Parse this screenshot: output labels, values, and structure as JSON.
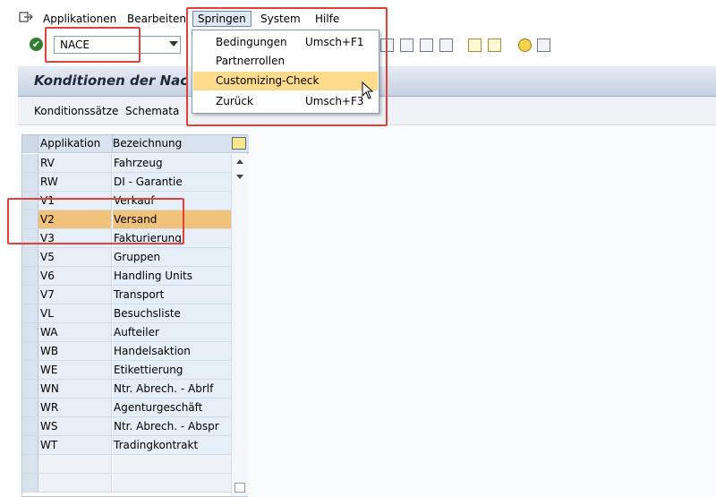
{
  "menubar": {
    "items": [
      "Applikationen",
      "Bearbeiten",
      "Springen",
      "System",
      "Hilfe"
    ]
  },
  "toolbar": {
    "command_value": "NACE"
  },
  "title": "Konditionen der Nac",
  "app_toolbar": {
    "buttons": [
      "Konditionssätze",
      "Schemata"
    ]
  },
  "table": {
    "headers": [
      "Applikation",
      "Bezeichnung"
    ],
    "rows": [
      {
        "app": "RV",
        "desc": "Fahrzeug"
      },
      {
        "app": "RW",
        "desc": "DI - Garantie"
      },
      {
        "app": "V1",
        "desc": "Verkauf"
      },
      {
        "app": "V2",
        "desc": "Versand"
      },
      {
        "app": "V3",
        "desc": "Fakturierung"
      },
      {
        "app": "V5",
        "desc": "Gruppen"
      },
      {
        "app": "V6",
        "desc": "Handling Units"
      },
      {
        "app": "V7",
        "desc": "Transport"
      },
      {
        "app": "VL",
        "desc": "Besuchsliste"
      },
      {
        "app": "WA",
        "desc": "Aufteiler"
      },
      {
        "app": "WB",
        "desc": "Handelsaktion"
      },
      {
        "app": "WE",
        "desc": "Etikettierung"
      },
      {
        "app": "WN",
        "desc": "Ntr. Abrech. - Abrlf"
      },
      {
        "app": "WR",
        "desc": "Agenturgeschäft"
      },
      {
        "app": "WS",
        "desc": "Ntr. Abrech. - Abspr"
      },
      {
        "app": "WT",
        "desc": "Tradingkontrakt"
      }
    ]
  },
  "dropdown": {
    "items": [
      {
        "label": "Bedingungen",
        "shortcut": "Umsch+F1"
      },
      {
        "label": "Partnerrollen",
        "shortcut": ""
      },
      {
        "label": "Customizing-Check",
        "shortcut": ""
      },
      {
        "label": "Zurück",
        "shortcut": "Umsch+F3"
      }
    ]
  },
  "colors": {
    "selected_row": "#f1c27a",
    "menu_highlight": "#fcdc8c",
    "annotation": "#e0413b"
  }
}
